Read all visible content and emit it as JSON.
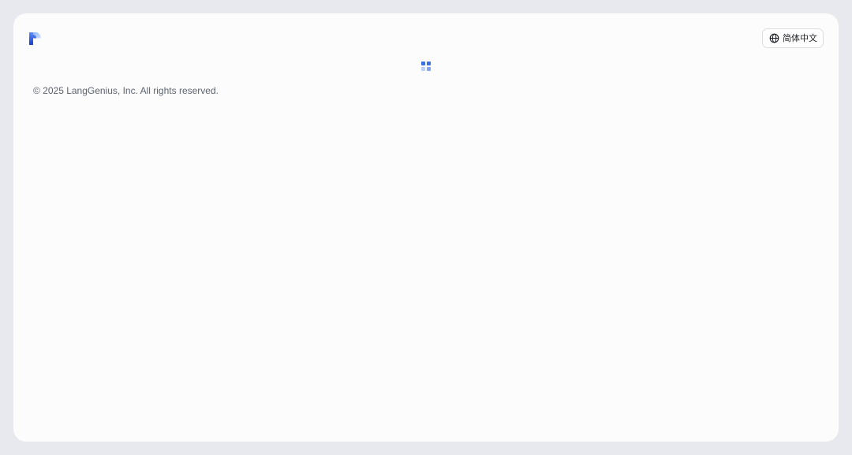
{
  "header": {
    "logo_icon": "dify-logo-icon",
    "language_button": {
      "icon": "globe-icon",
      "label": "简体中文"
    }
  },
  "loader": {
    "icon": "loading-grid-icon",
    "colors": [
      "#3a6fe0",
      "#3a6fe0",
      "#bcd0f5",
      "#7fa3ec"
    ]
  },
  "footer": {
    "copyright": "© 2025 LangGenius, Inc. All rights reserved."
  },
  "colors": {
    "page_background": "#e8e9ee",
    "card_background": "#fcfcfc",
    "accent": "#3a6fe0"
  }
}
